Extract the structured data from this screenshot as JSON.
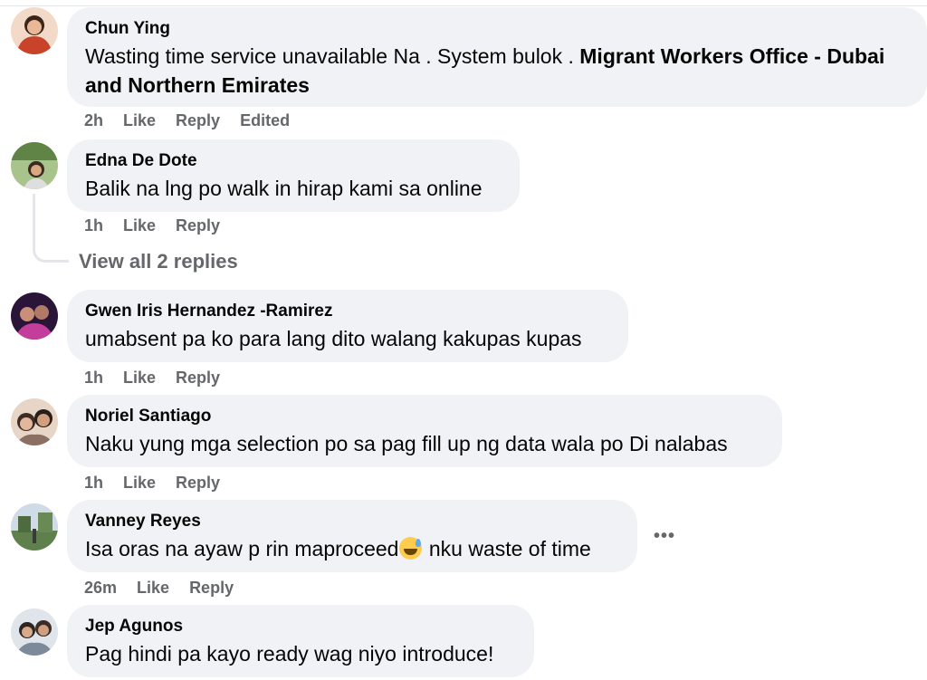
{
  "comments": [
    {
      "author": "Chun Ying",
      "text": "Wasting time service unavailable Na . System bulok . ",
      "mention": "Migrant Workers Office - Dubai and Northern Emirates",
      "time": "2h",
      "like": "Like",
      "reply": "Reply",
      "edited": "Edited",
      "avatar_colors": [
        "#b5452a",
        "#e8793c"
      ]
    },
    {
      "author": "Edna De Dote",
      "text": "Balik na lng po walk in hirap kami sa online",
      "time": "1h",
      "like": "Like",
      "reply": "Reply",
      "view_replies": "View all 2 replies",
      "avatar_colors": [
        "#6f8f52",
        "#c9b6a5"
      ]
    },
    {
      "author": "Gwen Iris Hernandez -Ramirez",
      "text": "umabsent pa ko para lang dito walang kakupas kupas",
      "time": "1h",
      "like": "Like",
      "reply": "Reply",
      "avatar_colors": [
        "#3a1d4e",
        "#b03a8a"
      ]
    },
    {
      "author": "Noriel Santiago",
      "text": "Naku yung mga selection po sa pag fill up ng data wala po Di nalabas",
      "time": "1h",
      "like": "Like",
      "reply": "Reply",
      "avatar_colors": [
        "#d8b8a2",
        "#7d6a5c"
      ]
    },
    {
      "author": "Vanney Reyes",
      "text_before": "Isa oras na ayaw p rin maproceed",
      "emoji": "sweat-smile-emoji",
      "text_after": " nku waste of time",
      "time": "26m",
      "like": "Like",
      "reply": "Reply",
      "more": "•••",
      "avatar_colors": [
        "#6b8a5a",
        "#c8d4df"
      ]
    },
    {
      "author": "Jep Agunos",
      "text": "Pag hindi pa kayo ready wag niyo introduce!",
      "avatar_colors": [
        "#9aa7b5",
        "#d7b79c"
      ]
    }
  ]
}
